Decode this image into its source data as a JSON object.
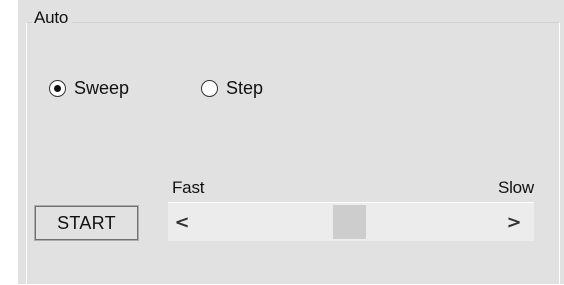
{
  "group": {
    "title": "Auto"
  },
  "mode": {
    "options": [
      {
        "label": "Sweep",
        "selected": true
      },
      {
        "label": "Step",
        "selected": false
      }
    ]
  },
  "speed": {
    "min_label": "Fast",
    "max_label": "Slow",
    "value_fraction": 0.5,
    "left_arrow": "<",
    "right_arrow": ">"
  },
  "controls": {
    "start_label": "START"
  },
  "colors": {
    "panel_background": "#e1e1e1",
    "scrollbar_track": "#ececec",
    "scrollbar_thumb": "#cdcdcd"
  }
}
